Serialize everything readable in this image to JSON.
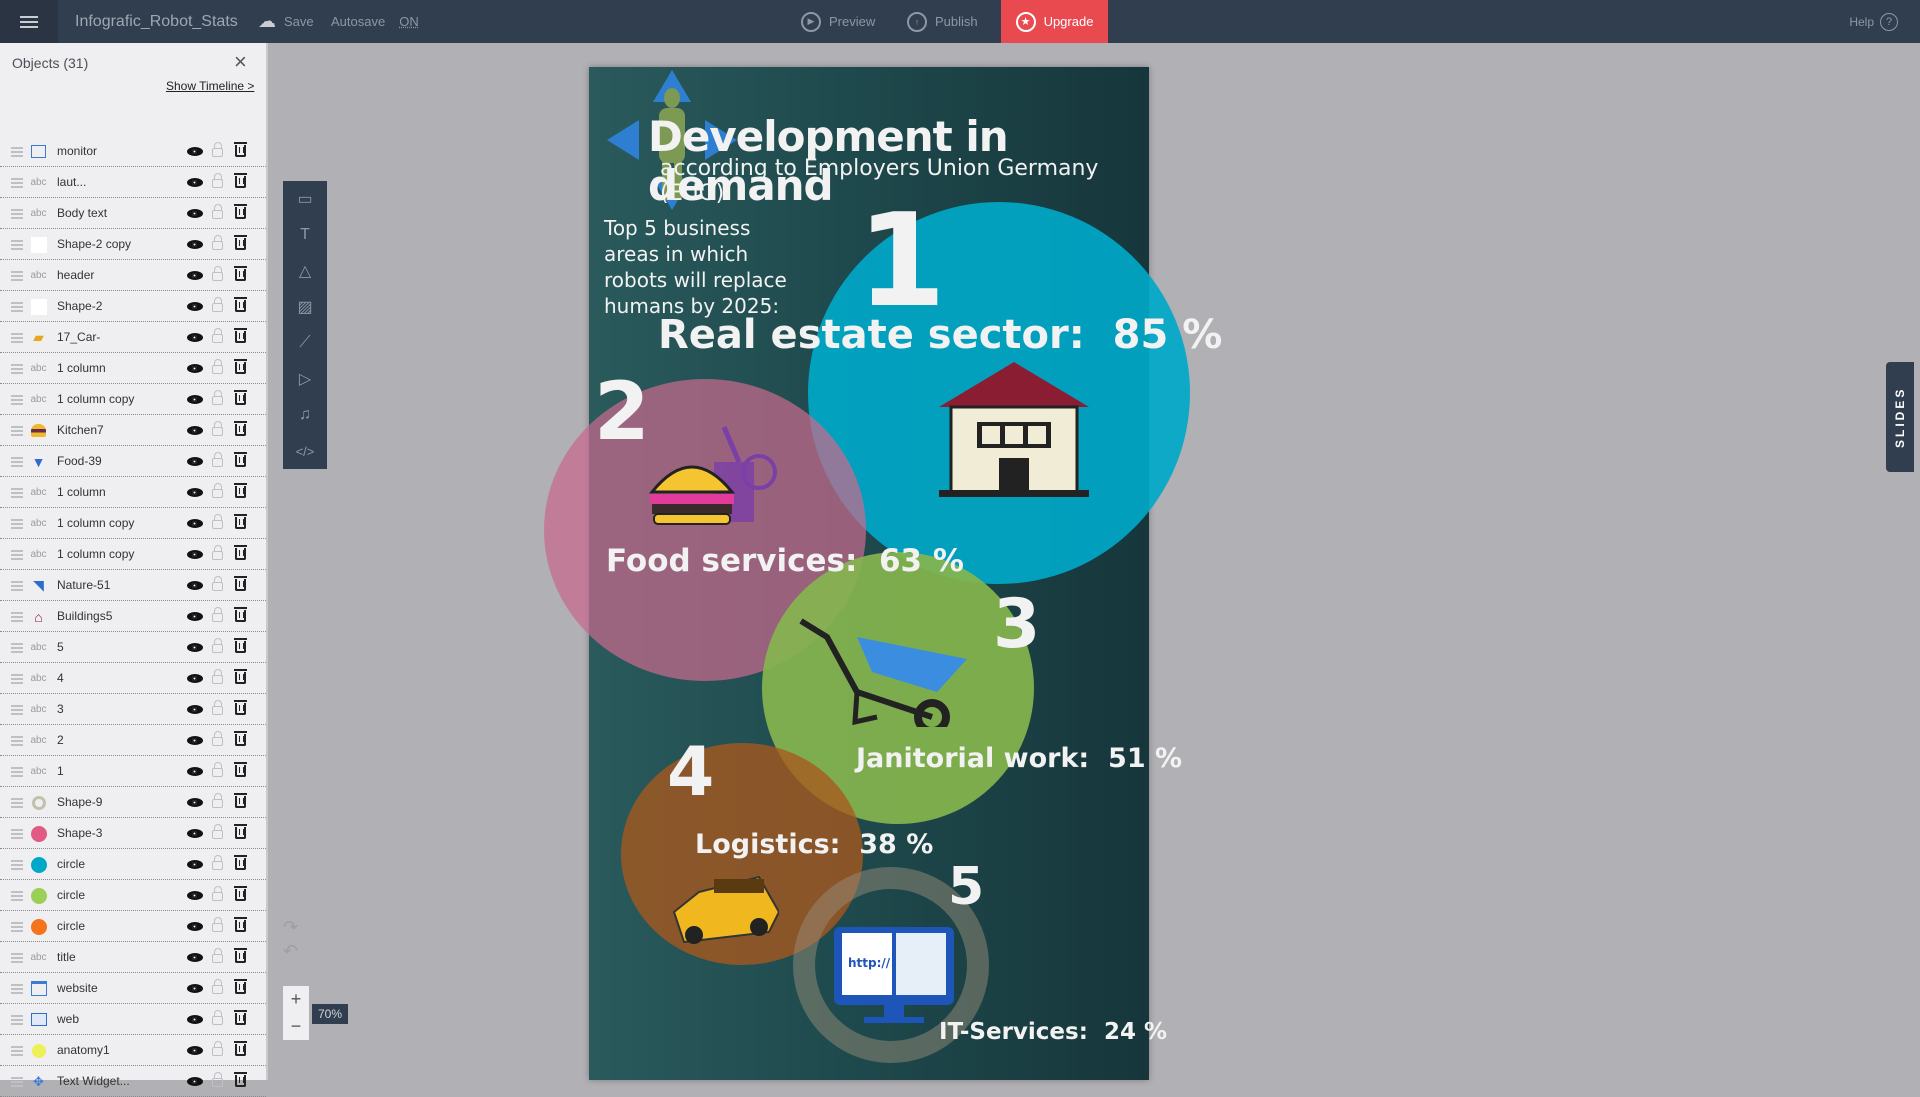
{
  "topbar": {
    "menu_icon": "hamburger-icon",
    "doc_title": "Infografic_Robot_Stats",
    "save_label": "Save",
    "autosave_label": "Autosave",
    "autosave_value": "ON",
    "preview_label": "Preview",
    "publish_label": "Publish",
    "upgrade_label": "Upgrade",
    "help_label": "Help"
  },
  "panel": {
    "title": "Objects (31)",
    "timeline_link": "Show Timeline >",
    "items": [
      {
        "name": "monitor",
        "type": "monitor-icon"
      },
      {
        "name": "laut...",
        "type": "text-icon"
      },
      {
        "name": "Body text",
        "type": "text-icon"
      },
      {
        "name": "Shape-2 copy",
        "type": "white-square-icon"
      },
      {
        "name": "header",
        "type": "text-icon"
      },
      {
        "name": "Shape-2",
        "type": "white-square-icon"
      },
      {
        "name": "17_Car-",
        "type": "car-icon"
      },
      {
        "name": "1 column",
        "type": "text-icon"
      },
      {
        "name": "1 column copy",
        "type": "text-icon"
      },
      {
        "name": "Kitchen7",
        "type": "burger-icon"
      },
      {
        "name": "Food-39",
        "type": "drink-icon"
      },
      {
        "name": "1 column",
        "type": "text-icon"
      },
      {
        "name": "1 column copy",
        "type": "text-icon"
      },
      {
        "name": "1 column copy",
        "type": "text-icon"
      },
      {
        "name": "Nature-51",
        "type": "wheelbarrow-icon"
      },
      {
        "name": "Buildings5",
        "type": "house-icon"
      },
      {
        "name": "5",
        "type": "text-icon"
      },
      {
        "name": "4",
        "type": "text-icon"
      },
      {
        "name": "3",
        "type": "text-icon"
      },
      {
        "name": "2",
        "type": "text-icon"
      },
      {
        "name": "1",
        "type": "text-icon"
      },
      {
        "name": "Shape-9",
        "type": "ring-icon"
      },
      {
        "name": "Shape-3",
        "type": "pink-circle-icon"
      },
      {
        "name": "circle",
        "type": "cyan-circle-icon"
      },
      {
        "name": "circle",
        "type": "green-circle-icon"
      },
      {
        "name": "circle",
        "type": "orange-circle-icon"
      },
      {
        "name": "title",
        "type": "text-icon"
      },
      {
        "name": "website",
        "type": "website-icon"
      },
      {
        "name": "web",
        "type": "web-icon"
      },
      {
        "name": "anatomy1",
        "type": "yellow-circle-icon"
      },
      {
        "name": "Text Widget...",
        "type": "move-icon"
      }
    ]
  },
  "tools": [
    "layout-icon",
    "text-tool-icon",
    "shapes-icon",
    "image-icon",
    "chart-icon",
    "media-icon",
    "audio-icon",
    "code-icon"
  ],
  "zoom_level": "70%",
  "slides_label": "SLIDES",
  "infographic": {
    "title": "Development in demand",
    "subtitle": "according to Employers Union Germany (EUG)",
    "intro": [
      "Top 5 business",
      "areas in which",
      "robots will replace",
      "humans by 2025:"
    ],
    "entries": [
      {
        "rank": "1",
        "label": "Real estate sector:",
        "value": "85 %",
        "color": "#00a8c8"
      },
      {
        "rank": "2",
        "label": "Food services:",
        "value": "63 %",
        "color": "#c86a8e"
      },
      {
        "rank": "3",
        "label": "Janitorial work:",
        "value": "51 %",
        "color": "#86b54e"
      },
      {
        "rank": "4",
        "label": "Logistics:",
        "value": "38 %",
        "color": "#a8591e"
      },
      {
        "rank": "5",
        "label": "IT-Services:",
        "value": "24 %",
        "color": "#7a7a6c"
      }
    ]
  },
  "colors": {
    "topbar": "#313e50",
    "upgrade": "#e84a4f",
    "panel": "#efeef1",
    "workspace": "#b1b0b4"
  }
}
